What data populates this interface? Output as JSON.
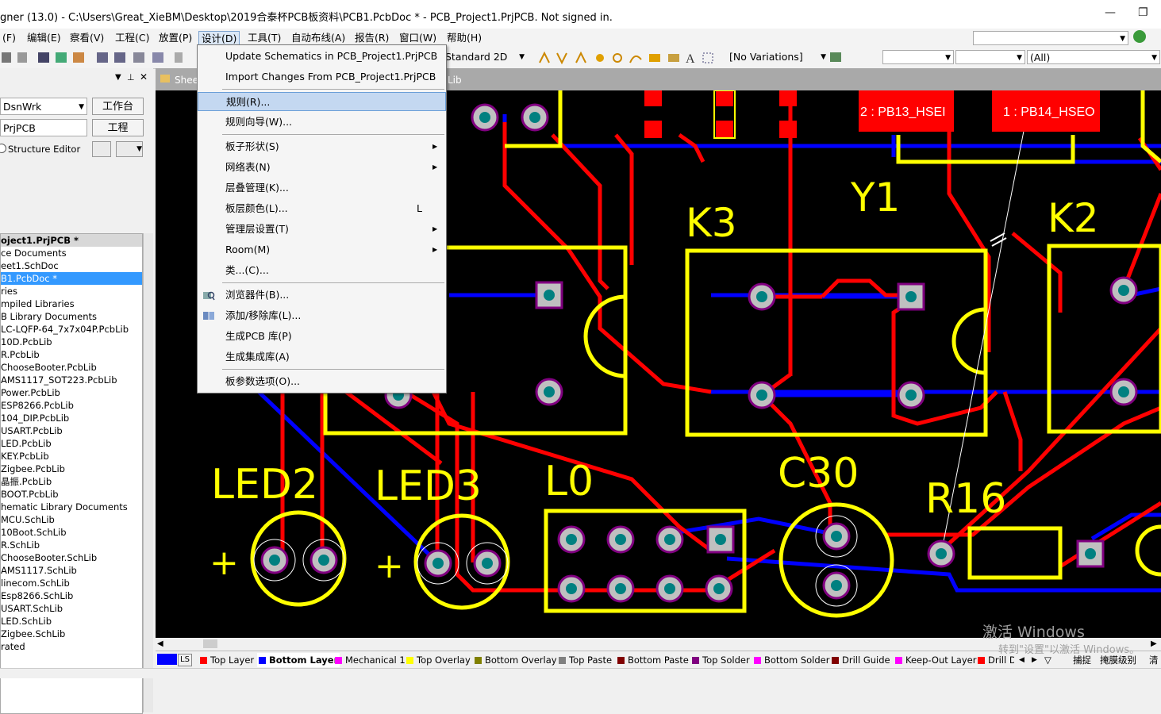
{
  "window": {
    "title": "gner (13.0) - C:\\Users\\Great_XieBM\\Desktop\\2019合泰杯PCB板资料\\PCB1.PcbDoc * - PCB_Project1.PrjPCB. Not signed in."
  },
  "menubar": [
    "(F)",
    "编辑(E)",
    "察看(V)",
    "工程(C)",
    "放置(P)",
    "设计(D)",
    "工具(T)",
    "自动布线(A)",
    "报告(R)",
    "窗口(W)",
    "帮助(H)"
  ],
  "toolbar": {
    "view_mode": "Standard 2D",
    "variations": "[No Variations]",
    "filter": "(All)"
  },
  "left_panel": {
    "workspace_combo": "DsnWrk",
    "workspace_button": "工作台",
    "project_field": "PrjPCB",
    "project_button": "工程",
    "structure_editor": "Structure Editor",
    "tree": [
      "oject1.PrjPCB *",
      "ce Documents",
      "eet1.SchDoc",
      "B1.PcbDoc *",
      "ries",
      "mpiled Libraries",
      "B Library Documents",
      "LC-LQFP-64_7x7x04P.PcbLib",
      "10D.PcbLib",
      "R.PcbLib",
      "ChooseBooter.PcbLib",
      "AMS1117_SOT223.PcbLib",
      "Power.PcbLib",
      "ESP8266.PcbLib",
      "104_DIP.PcbLib",
      "USART.PcbLib",
      "LED.PcbLib",
      "KEY.PcbLib",
      "Zigbee.PcbLib",
      "晶振.PcbLib",
      "BOOT.PcbLib",
      "hematic Library Documents",
      "MCU.SchLib",
      "10Boot.SchLib",
      "R.SchLib",
      "ChooseBooter.SchLib",
      "AMS1117.SchLib",
      "linecom.SchLib",
      "Esp8266.SchLib",
      "USART.SchLib",
      "LED.SchLib",
      "Zigbee.SchLib",
      "rated"
    ]
  },
  "doc_tabs": [
    "Sheet",
    "Lib"
  ],
  "design_menu": {
    "items": [
      {
        "label": "Update Schematics in PCB_Project1.PrjPCB"
      },
      {
        "label": "Import Changes From PCB_Project1.PrjPCB"
      },
      {
        "label": "规则(R)..."
      },
      {
        "label": "规则向导(W)..."
      },
      {
        "label": "板子形状(S)"
      },
      {
        "label": "网络表(N)"
      },
      {
        "label": "层叠管理(K)..."
      },
      {
        "label": "板层颜色(L)...",
        "shortcut": "L"
      },
      {
        "label": "管理层设置(T)"
      },
      {
        "label": "Room(M)"
      },
      {
        "label": "类...(C)..."
      },
      {
        "label": "浏览器件(B)..."
      },
      {
        "label": "添加/移除库(L)..."
      },
      {
        "label": "生成PCB 库(P)"
      },
      {
        "label": "生成集成库(A)"
      },
      {
        "label": "板参数选项(O)..."
      }
    ]
  },
  "pcb": {
    "designators": [
      "K3",
      "Y1",
      "K2",
      "LED2",
      "LED3",
      "L0",
      "C30",
      "R16"
    ],
    "pad_labels": [
      "2 : PB13_HSEI",
      "1 : PB14_HSEO"
    ],
    "plus_sign": "+"
  },
  "layer_tabs": [
    {
      "label": "LS",
      "color": "#0000ff"
    },
    {
      "label": "Top Layer",
      "color": "#ff0000"
    },
    {
      "label": "Bottom Layer",
      "color": "#0000ff"
    },
    {
      "label": "Mechanical 1",
      "color": "#ff00ff"
    },
    {
      "label": "Top Overlay",
      "color": "#ffff00"
    },
    {
      "label": "Bottom Overlay",
      "color": "#808000"
    },
    {
      "label": "Top Paste",
      "color": "#808080"
    },
    {
      "label": "Bottom Paste",
      "color": "#800000"
    },
    {
      "label": "Top Solder",
      "color": "#800080"
    },
    {
      "label": "Bottom Solder",
      "color": "#ff00ff"
    },
    {
      "label": "Drill Guide",
      "color": "#800000"
    },
    {
      "label": "Keep-Out Layer",
      "color": "#ff00ff"
    },
    {
      "label": "Drill D",
      "color": "#ff0000"
    }
  ],
  "status_right": {
    "snap": "捕捉",
    "mask": "掩膜级别",
    "clear": "清"
  },
  "watermark": {
    "line1": "激活 Windows",
    "line2": "转到\"设置\"以激活 Windows。"
  },
  "colors": {
    "track_top": "#ff0000",
    "track_bottom": "#0000ff",
    "overlay": "#ffff00",
    "pad": "#c0c0c0",
    "hole": "#008080",
    "pad_ring": "#800080",
    "menu_highlight": "#c4d8f1"
  }
}
